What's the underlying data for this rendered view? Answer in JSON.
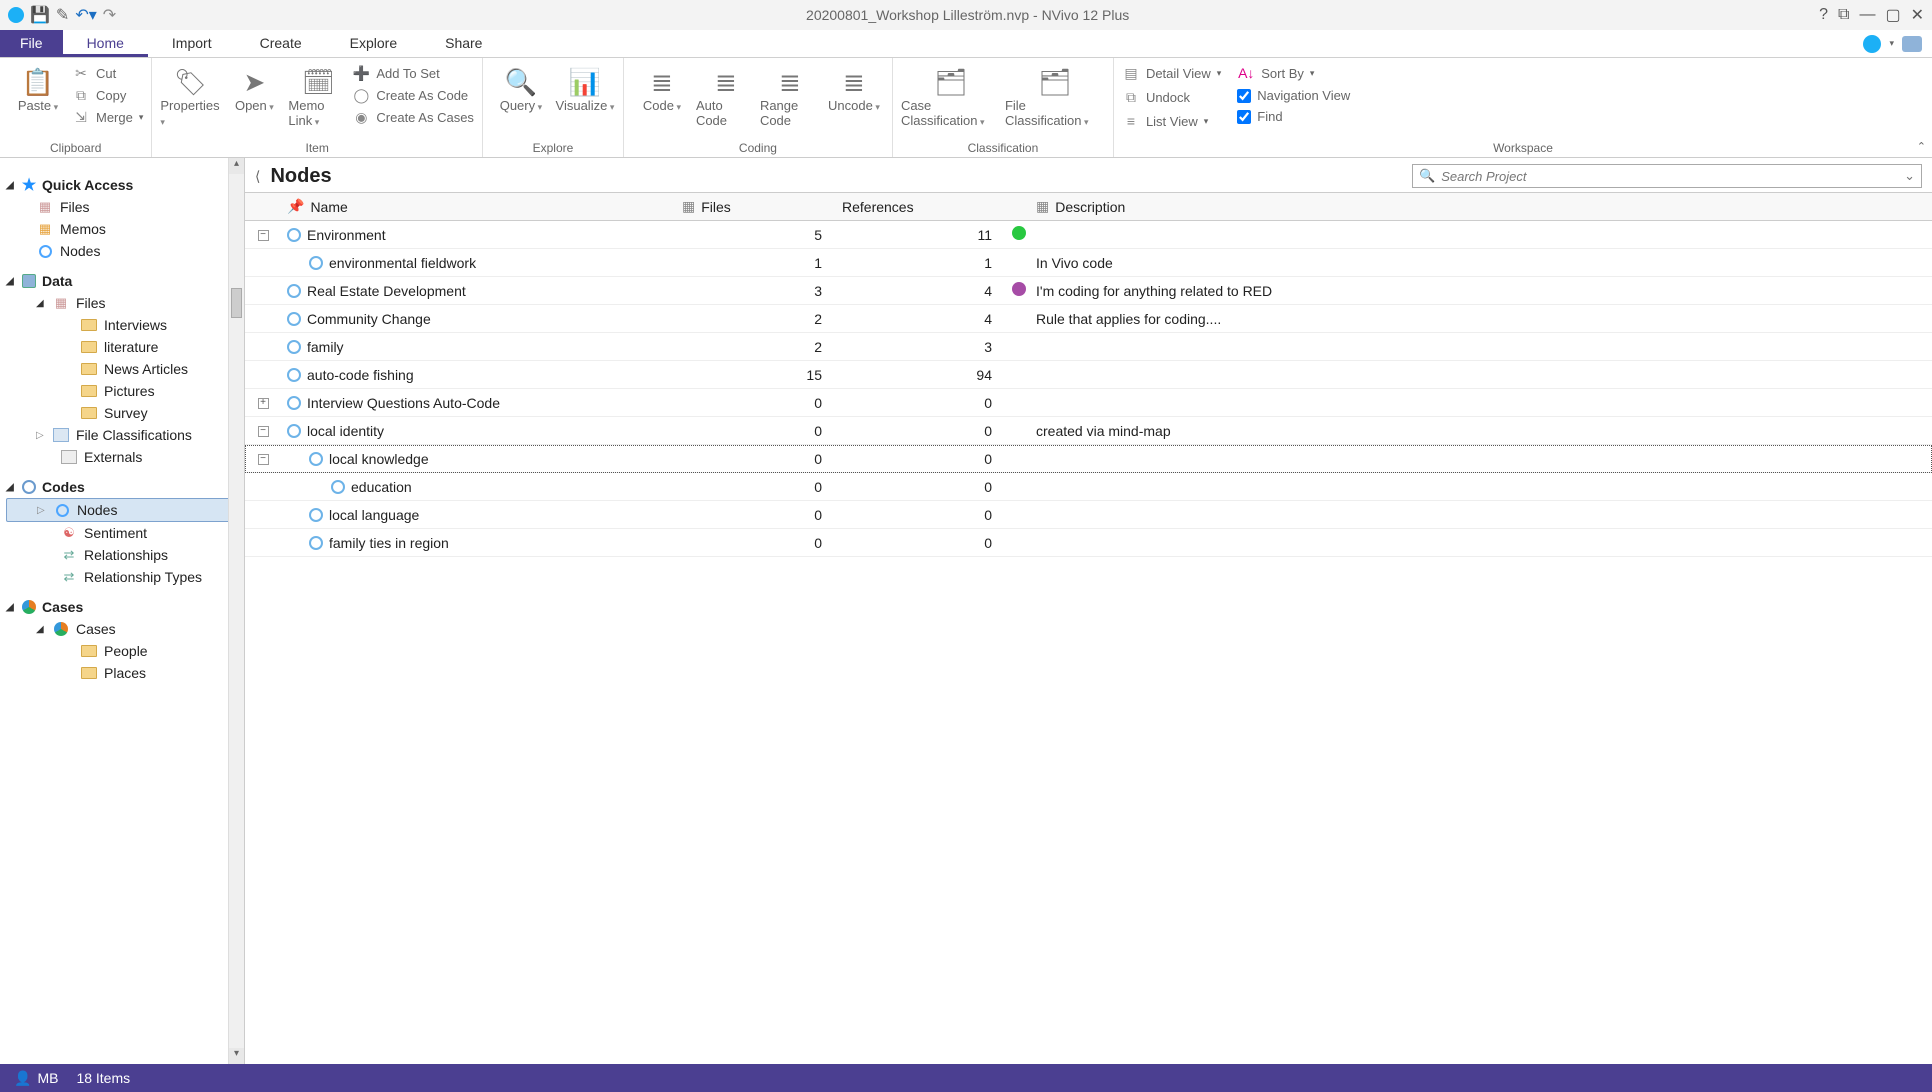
{
  "titlebar": {
    "title": "20200801_Workshop Lilleström.nvp - NVivo 12 Plus"
  },
  "window_buttons": {
    "help": "?",
    "restore": "⧉",
    "min": "—",
    "max": "▢",
    "close": "✕"
  },
  "menu": {
    "file": "File",
    "tabs": [
      "Home",
      "Import",
      "Create",
      "Explore",
      "Share"
    ],
    "active": "Home"
  },
  "ribbon": {
    "clipboard": {
      "paste": "Paste",
      "cut": "Cut",
      "copy": "Copy",
      "merge": "Merge",
      "label": "Clipboard"
    },
    "item": {
      "properties": "Properties",
      "open": "Open",
      "memo": "Memo Link",
      "addtoset": "Add To Set",
      "createcode": "Create As Code",
      "createcases": "Create As Cases",
      "label": "Item"
    },
    "explore": {
      "query": "Query",
      "visualize": "Visualize",
      "label": "Explore"
    },
    "coding": {
      "code": "Code",
      "auto": "Auto Code",
      "range": "Range Code",
      "uncode": "Uncode",
      "label": "Coding"
    },
    "classification": {
      "case": "Case Classification",
      "file": "File Classification",
      "label": "Classification"
    },
    "workspace": {
      "detail": "Detail View",
      "sort": "Sort By",
      "undock": "Undock",
      "navview": "Navigation View",
      "listview": "List View",
      "find": "Find",
      "label": "Workspace"
    }
  },
  "nav": {
    "quick_access": {
      "title": "Quick Access",
      "files": "Files",
      "memos": "Memos",
      "nodes": "Nodes"
    },
    "data": {
      "title": "Data",
      "files": "Files",
      "interviews": "Interviews",
      "literature": "literature",
      "news": "News Articles",
      "pictures": "Pictures",
      "survey": "Survey",
      "fc": "File Classifications",
      "externals": "Externals"
    },
    "codes": {
      "title": "Codes",
      "nodes": "Nodes",
      "sentiment": "Sentiment",
      "relationships": "Relationships",
      "reltypes": "Relationship Types"
    },
    "cases": {
      "title": "Cases",
      "cases": "Cases",
      "people": "People",
      "places": "Places"
    }
  },
  "main": {
    "heading": "Nodes",
    "search_placeholder": "Search Project",
    "columns": {
      "name": "Name",
      "files": "Files",
      "refs": "References",
      "desc": "Description"
    }
  },
  "rows": [
    {
      "exp": "⊟",
      "indent": 0,
      "name": "Environment",
      "files": "5",
      "refs": "11",
      "dot": "g",
      "desc": ""
    },
    {
      "exp": "",
      "indent": 1,
      "name": "environmental fieldwork",
      "files": "1",
      "refs": "1",
      "dot": "",
      "desc": "In Vivo code"
    },
    {
      "exp": "",
      "indent": 0,
      "name": "Real Estate Development",
      "files": "3",
      "refs": "4",
      "dot": "p",
      "desc": "I'm coding for anything related to RED"
    },
    {
      "exp": "",
      "indent": 0,
      "name": "Community Change",
      "files": "2",
      "refs": "4",
      "dot": "",
      "desc": "Rule that applies for coding...."
    },
    {
      "exp": "",
      "indent": 0,
      "name": "family",
      "files": "2",
      "refs": "3",
      "dot": "",
      "desc": ""
    },
    {
      "exp": "",
      "indent": 0,
      "name": "auto-code fishing",
      "files": "15",
      "refs": "94",
      "dot": "",
      "desc": ""
    },
    {
      "exp": "⊞",
      "indent": 0,
      "name": "Interview Questions Auto-Code",
      "files": "0",
      "refs": "0",
      "dot": "",
      "desc": ""
    },
    {
      "exp": "⊟",
      "indent": 0,
      "name": "local identity",
      "files": "0",
      "refs": "0",
      "dot": "",
      "desc": "created via  mind-map"
    },
    {
      "exp": "⊟",
      "indent": 1,
      "name": "local knowledge",
      "files": "0",
      "refs": "0",
      "dot": "",
      "desc": "",
      "sel": true
    },
    {
      "exp": "",
      "indent": 2,
      "name": "education",
      "files": "0",
      "refs": "0",
      "dot": "",
      "desc": ""
    },
    {
      "exp": "",
      "indent": 1,
      "name": "local language",
      "files": "0",
      "refs": "0",
      "dot": "",
      "desc": ""
    },
    {
      "exp": "",
      "indent": 1,
      "name": "family ties in region",
      "files": "0",
      "refs": "0",
      "dot": "",
      "desc": ""
    }
  ],
  "status": {
    "user": "MB",
    "items": "18 Items"
  }
}
